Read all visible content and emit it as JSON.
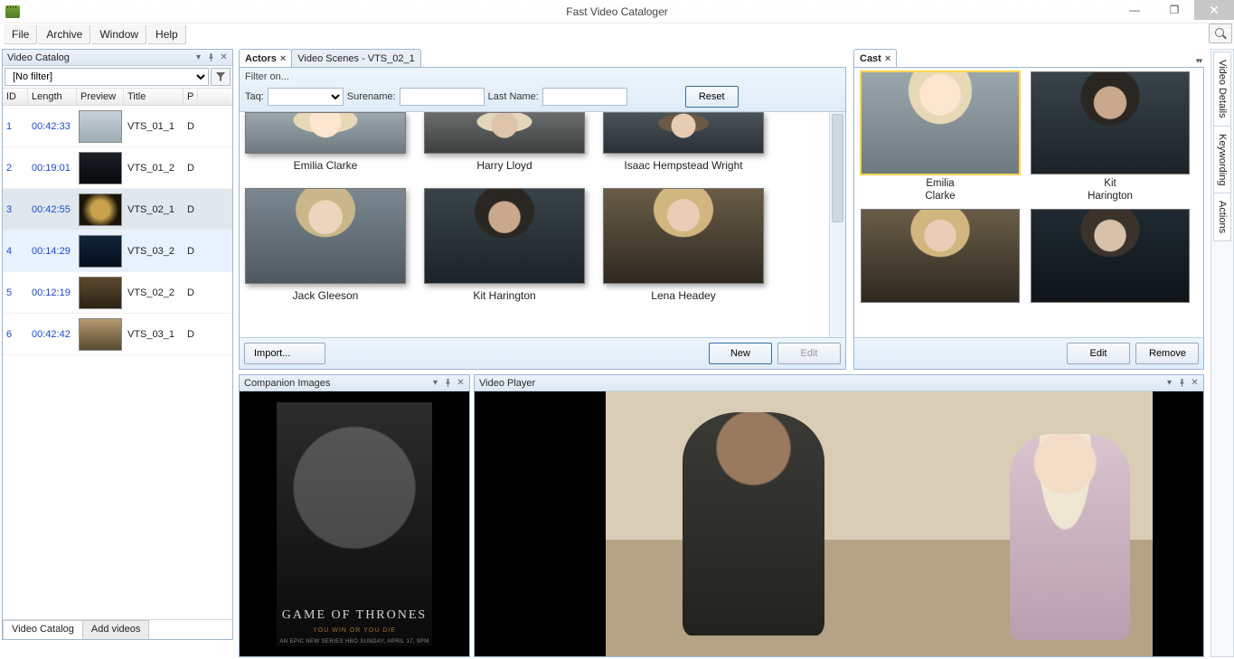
{
  "window": {
    "title": "Fast Video Cataloger"
  },
  "menubar": {
    "file": "File",
    "archive": "Archive",
    "window": "Window",
    "help": "Help"
  },
  "left_panel": {
    "title": "Video Catalog",
    "filter_value": "[No filter]",
    "columns": {
      "id": "ID",
      "length": "Length",
      "preview": "Preview",
      "title": "Title",
      "p": "P"
    },
    "rows": [
      {
        "id": "1",
        "length": "00:42:33",
        "title": "VTS_01_1",
        "p": "D",
        "thumb": "th-snow"
      },
      {
        "id": "2",
        "length": "00:19:01",
        "title": "VTS_01_2",
        "p": "D",
        "thumb": "th-dark"
      },
      {
        "id": "3",
        "length": "00:42:55",
        "title": "VTS_02_1",
        "p": "D",
        "thumb": "th-gold",
        "selected": true
      },
      {
        "id": "4",
        "length": "00:14:29",
        "title": "VTS_03_2",
        "p": "D",
        "thumb": "th-blue",
        "highlight": true
      },
      {
        "id": "5",
        "length": "00:12:19",
        "title": "VTS_02_2",
        "p": "D",
        "thumb": "th-room"
      },
      {
        "id": "6",
        "length": "00:42:42",
        "title": "VTS_03_1",
        "p": "D",
        "thumb": "th-land"
      }
    ],
    "tabs": {
      "catalog": "Video Catalog",
      "add": "Add videos"
    }
  },
  "doc_tabs": {
    "actors": "Actors",
    "scenes": "Video Scenes - VTS_02_1"
  },
  "actors": {
    "filter_on": "Filter on...",
    "tag_label": "Taq:",
    "surname_label": "Surename:",
    "lastname_label": "Last Name:",
    "reset": "Reset",
    "import": "Import...",
    "new": "New",
    "edit": "Edit",
    "list": [
      {
        "name": "Emilia Clarke",
        "cls": "blonde",
        "top": true
      },
      {
        "name": "Harry Lloyd",
        "cls": "harry",
        "top": true
      },
      {
        "name": "Isaac Hempstead Wright",
        "cls": "boy",
        "top": true
      },
      {
        "name": "Jack Gleeson",
        "cls": "blond-boy"
      },
      {
        "name": "Kit Harington",
        "cls": "male-dark"
      },
      {
        "name": "Lena Headey",
        "cls": "woman-red"
      }
    ]
  },
  "cast": {
    "tab": "Cast",
    "edit": "Edit",
    "remove": "Remove",
    "items": [
      {
        "first": "Emilia",
        "last": "Clarke",
        "cls": "blonde",
        "selected": true
      },
      {
        "first": "Kit",
        "last": "Harington",
        "cls": "male-dark"
      },
      {
        "first": "",
        "last": "",
        "cls": "woman-red",
        "bottom": true
      },
      {
        "first": "",
        "last": "",
        "cls": "woman-dark",
        "bottom": true
      }
    ]
  },
  "companion": {
    "title": "Companion Images",
    "poster_title": "GAME OF THRONES",
    "poster_sub": "YOU WIN OR YOU DIE",
    "poster_foot": "AN EPIC NEW SERIES   HBO   SUNDAY, APRIL 17, 9PM"
  },
  "vplayer": {
    "title": "Video Player"
  },
  "vtabs": {
    "details": "Video Details",
    "keywording": "Keywording",
    "actions": "Actions"
  }
}
